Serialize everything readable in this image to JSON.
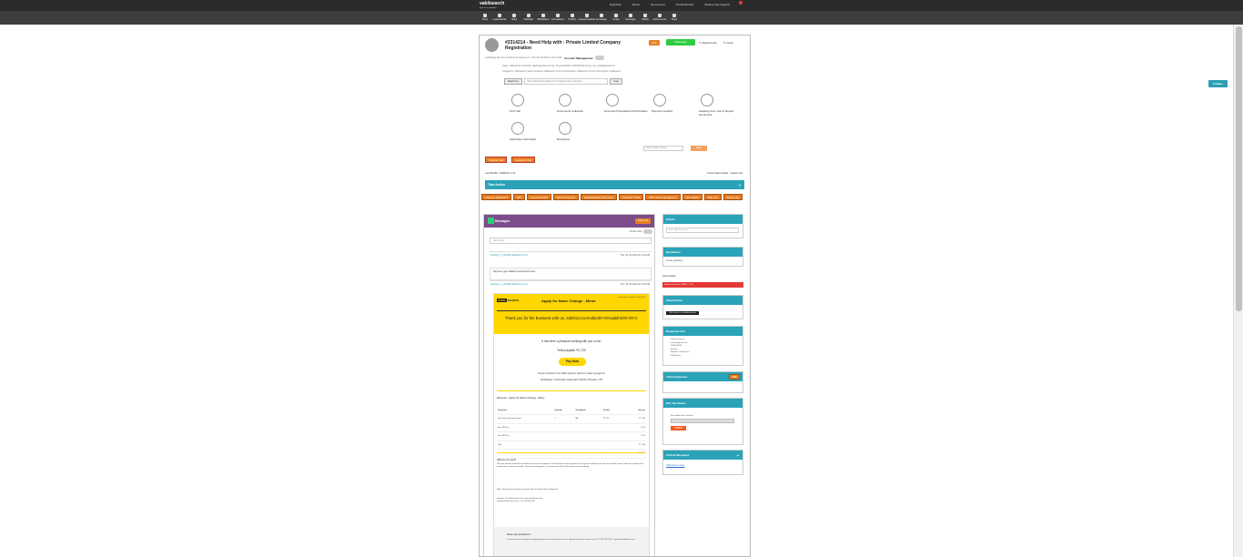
{
  "topbar": {
    "logo": "vakilsearch",
    "logo_tag": "legal & tax simplified",
    "links": [
      "Helpdesk",
      "Admin",
      "My Account",
      "VS Dashboard",
      "Testing User (logout)"
    ]
  },
  "navbar": {
    "items": [
      "Home",
      "Leaderboards",
      "Tasks",
      "Wildcatter",
      "Wildcalldocs",
      "Formulations",
      "Postbox",
      "Lawyers/Verticals",
      "Knowledge",
      "Scripts",
      "Messages",
      "Validity",
      "Dodocuments",
      "Share"
    ]
  },
  "collapse_label": "Collaps",
  "ticket": {
    "title": "#2314214 - Need Help with : Private Limited Company Registration",
    "edit_label": "Edit",
    "whatsapp_label": "Whatsapp",
    "attachments_label": "Attachments",
    "close_label": "Close",
    "meta": "saskhi@gmail.com reported via request on | Thu 04 Jul 2023 at 11:14 AM",
    "account_mgmt_label": "Account Management",
    "detail1": "Name: Vakilsearch-test  Email: saskhi@gmail.com  City: Chennai  Mobile: 9780000000  Service city: saskhi@gmail.com",
    "detail2": "Assigned to: Vakilsearch  Lawyer Assigned: Vakilsearch  Current Subscription: Vakilsearch  Current Subscription: Vakilsearch",
    "magic_label": "Magic Key",
    "magic_value": "https://dashboard.vakilsearch.com/login/magic_link/token",
    "copy_label": "Copy"
  },
  "steps": [
    "First Call",
    "Documents Collection",
    "Document Preparation/Confirmation",
    "Payment pending",
    "Awaiting Govt. Ack & Signed documents",
    "Application Submitted",
    "Resolution"
  ],
  "status_select_placeholder": "Select Status Update",
  "status_btn_label": "Save",
  "transfer_btn_label": "Transfer Call",
  "customer_call_btn_label": "Customer Call",
  "time_left": "Last Paid Bill - SubBill Pre 0:12",
  "time_right": "Tickets Status Details - Created 1:04",
  "take_action_label": "Take Action",
  "action_tabs": [
    "Customer Dashboard",
    "CRC",
    "Document Vault",
    "Verify Documents",
    "Upload/Delivery Documents",
    "Customer Profile",
    "CRC Library Management",
    "CRC Details",
    "Daily Info",
    "Activity Log"
  ],
  "messages": {
    "title": "Messages",
    "export_label": "Export All",
    "private_label": "Private Note",
    "filter_placeholder": "Add Notes",
    "items": [
      {
        "from": "testlogin_1_2023@vakilsearch.com",
        "when": "Thu, 06 Jul 2023 at 1:43 AM",
        "body": "Payment (gvt.related) Government Fees"
      },
      {
        "from": "testlogin_1_2023@vakilsearch.com",
        "when": "Thu, 06 Jul 2023 at 1:43 AM"
      }
    ]
  },
  "email": {
    "logo_dark": "VAKIL",
    "logo_light": "SEARCH",
    "title": "Apply for Name Change - Minor",
    "date": "Generated on Wed, 06 July 2023",
    "thanks": "Thank you for the Business with us, Sakthicccoorrodited!!!!!!!!!saakthil!!!!!!!!!!!!!!.",
    "pleasure": "It has been a pleasure working with you so far.",
    "total_payable": "Total payable ₹1,720",
    "pay_now": "Pay Now",
    "secure_note": "Secure checkout on our fitable payment options to make our payment",
    "methods": "Net Banking / Credit Card / Debit Card / PayTM / PhonePe / UPI",
    "invoice_title": "Discount - Apply for Name Change - Minor",
    "table_headers": [
      "Particulars",
      "Quantity",
      "Unit Agreed",
      "Cost(₹)",
      "Amount"
    ],
    "table_rows": [
      [
        "Govt. Fees & Stamp charges",
        "1",
        "NA",
        "₹ 1,720",
        "₹ 1,720"
      ],
      [
        "Govt 18% Tax",
        "",
        "",
        "",
        "₹ 0.0"
      ],
      [
        "Govt 18% Tax",
        "",
        "",
        "",
        "₹ 0.0"
      ],
      [
        "Total",
        "",
        "",
        "",
        "₹ 1,720"
      ],
      [
        "",
        "",
        "",
        "Grand total",
        "₹ 1,720"
      ]
    ],
    "next_title": "What to do next?",
    "next_text": "We have already started the formalities prior to your assignment. Post Payment on the payment link, the process will begin as soon as possible, please make the payment if the amount due as soon as possible. Post receipt of payment, our expert team will be able to proceed accordingly.",
    "note_text": "Note: Please do not entertain any calls other than those from Vakilsearch",
    "regards": "Regards, The Vakilsearch Team, www.vakilsearch.com, support@vakilsearch.com, +91 7200 365 365",
    "queries_title": "Have any questions?",
    "queries_text": "In case you have any queries regarding your ticket and want to reach our right person please connect with +91 7200 365 365 / support@vakilsearch.com"
  },
  "side": {
    "events_title": "Events",
    "events_placeholder": "Date - Add Date Here",
    "quotations_title": "Quotations",
    "quotations_text": "Create Quotation",
    "quote_label": "Quote Details",
    "red_row": "Vakilsearch Invoice 1234567 - 1720",
    "attachments_title": "Attachments",
    "attachments_btn": "Click Here to view Attachments",
    "requester_title": "Requester Info",
    "requester_lines": [
      "Vakilsearch-test",
      "saskhi@gmail.com",
      "9780000000",
      "English",
      "Member: Vakilsearch",
      "Sakthi Ram"
    ],
    "expenses_title": "Ticket Expenses",
    "expenses_btn": "Add",
    "pan_title": "Pan Tan Status",
    "pan_label": "Enter Application Number",
    "pan_submit": "SUBMIT",
    "critical_title": "Critical Messages",
    "critical_link": "Click here to view"
  }
}
